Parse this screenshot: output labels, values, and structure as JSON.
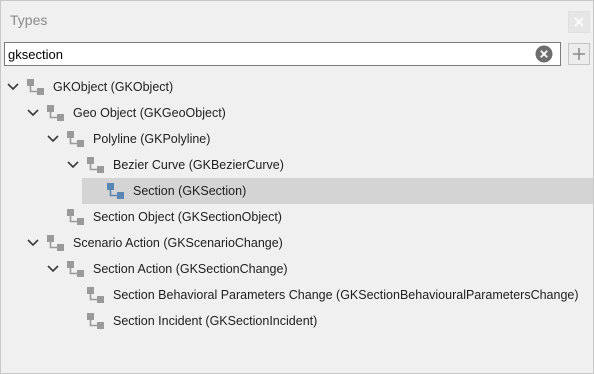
{
  "panel": {
    "title": "Types",
    "close_icon": "close-icon",
    "add_icon": "plus-icon",
    "clear_icon": "clear-circle-icon"
  },
  "search": {
    "value": "gksection"
  },
  "tree": {
    "nodes": [
      {
        "label": "GKObject (GKObject)",
        "expanded": true
      },
      {
        "label": "Geo Object (GKGeoObject)",
        "expanded": true
      },
      {
        "label": "Polyline (GKPolyline)",
        "expanded": true
      },
      {
        "label": "Bezier Curve (GKBezierCurve)",
        "expanded": true
      },
      {
        "label": "Section (GKSection)",
        "selected": true
      },
      {
        "label": "Section Object (GKSectionObject)"
      },
      {
        "label": "Scenario Action (GKScenarioChange)",
        "expanded": true
      },
      {
        "label": "Section Action (GKSectionChange)",
        "expanded": true
      },
      {
        "label": "Section Behavioral Parameters Change (GKSectionBehaviouralParametersChange)"
      },
      {
        "label": "Section Incident (GKSectionIncident)"
      }
    ]
  },
  "colors": {
    "selection": "#d4d4d4",
    "icon_gray": "#9a9a9a",
    "icon_selected": "#5b86b4"
  }
}
